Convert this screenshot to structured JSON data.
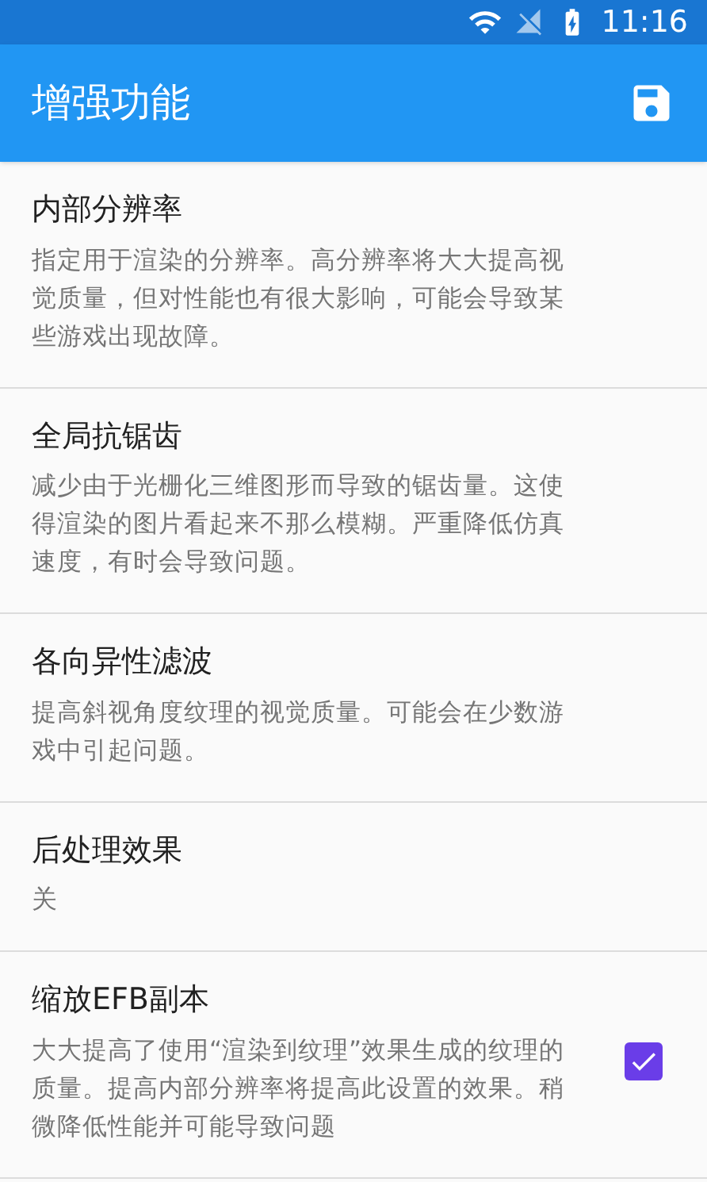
{
  "status_bar": {
    "time": "11:16"
  },
  "toolbar": {
    "title": "增强功能"
  },
  "settings": [
    {
      "kind": "text",
      "title": "内部分辨率",
      "description": "指定用于渲染的分辨率。高分辨率将大大提高视觉质量，但对性能也有很大影响，可能会导致某些游戏出现故障。"
    },
    {
      "kind": "text",
      "title": "全局抗锯齿",
      "description": "减少由于光栅化三维图形而导致的锯齿量。这使得渲染的图片看起来不那么模糊。严重降低仿真速度，有时会导致问题。"
    },
    {
      "kind": "text",
      "title": "各向异性滤波",
      "description": "提高斜视角度纹理的视觉质量。可能会在少数游戏中引起问题。"
    },
    {
      "kind": "value",
      "title": "后处理效果",
      "value": "关"
    },
    {
      "kind": "checkbox",
      "title": "缩放EFB副本",
      "description": "大大提高了使用“渲染到纹理”效果生成的纹理的质量。提高内部分辨率将提高此设置的效果。稍微降低性能并可能导致问题",
      "checked": true
    }
  ]
}
